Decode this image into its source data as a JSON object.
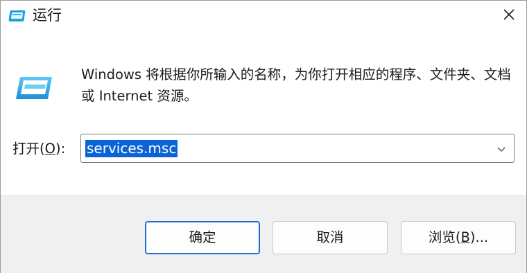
{
  "window": {
    "title": "运行",
    "close_label": "✕"
  },
  "dialog": {
    "description": "Windows 将根据你所输入的名称，为你打开相应的程序、文件夹、文档或 Internet 资源。",
    "open_label_prefix": "打开(",
    "open_label_key": "O",
    "open_label_suffix": "):",
    "command_value": "services.msc"
  },
  "buttons": {
    "ok": "确定",
    "cancel": "取消",
    "browse_prefix": "浏览(",
    "browse_key": "B",
    "browse_suffix": ")..."
  },
  "colors": {
    "accent": "#1e6ccf",
    "selection": "#0a64d6",
    "footer_bg": "#f0f0f0"
  },
  "icons": {
    "title": "run-dialog-icon",
    "main": "run-dialog-icon",
    "close": "close-icon",
    "dropdown": "chevron-down-icon"
  }
}
